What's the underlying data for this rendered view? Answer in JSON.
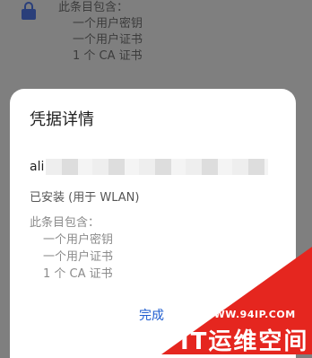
{
  "background": {
    "contains_title": "此条目包含：",
    "items": [
      "一个用户密钥",
      "一个用户证书",
      "1 个 CA 证书"
    ]
  },
  "dialog": {
    "title": "凭据详情",
    "credential_name_prefix": "ali",
    "installed_for": "已安装 (用于 WLAN)",
    "contains_title": "此条目包含：",
    "items": [
      "一个用户密钥",
      "一个用户证书",
      "1 个 CA 证书"
    ],
    "done_label": "完成"
  },
  "watermark": {
    "url": "WWW.94IP.COM",
    "brand": "IT运维空间"
  },
  "colors": {
    "accent": "#1e5ccf",
    "scrim": "#7f7f7f",
    "lock_icon": "#2a3f7a",
    "watermark": "#e5261f"
  },
  "icons": {
    "lock": "lock-icon"
  }
}
